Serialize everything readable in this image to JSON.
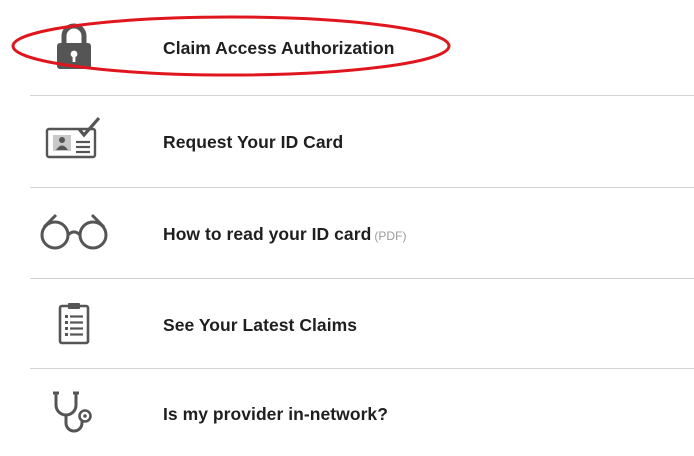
{
  "menu": {
    "items": [
      {
        "label": "Claim Access Authorization",
        "suffix": "",
        "icon": "lock-icon"
      },
      {
        "label": "Request Your ID Card",
        "suffix": "",
        "icon": "id-card-check-icon"
      },
      {
        "label": "How to read your ID card",
        "suffix": "(PDF)",
        "icon": "glasses-icon"
      },
      {
        "label": "See Your Latest Claims",
        "suffix": "",
        "icon": "clipboard-list-icon"
      },
      {
        "label": "Is my provider in-network?",
        "suffix": "",
        "icon": "stethoscope-icon"
      }
    ]
  },
  "colors": {
    "icon": "#555555",
    "highlight_ring": "#e0161e",
    "divider": "#d3d3d3",
    "text": "#1f1f1f",
    "suffix_text": "#9a9a9a"
  }
}
